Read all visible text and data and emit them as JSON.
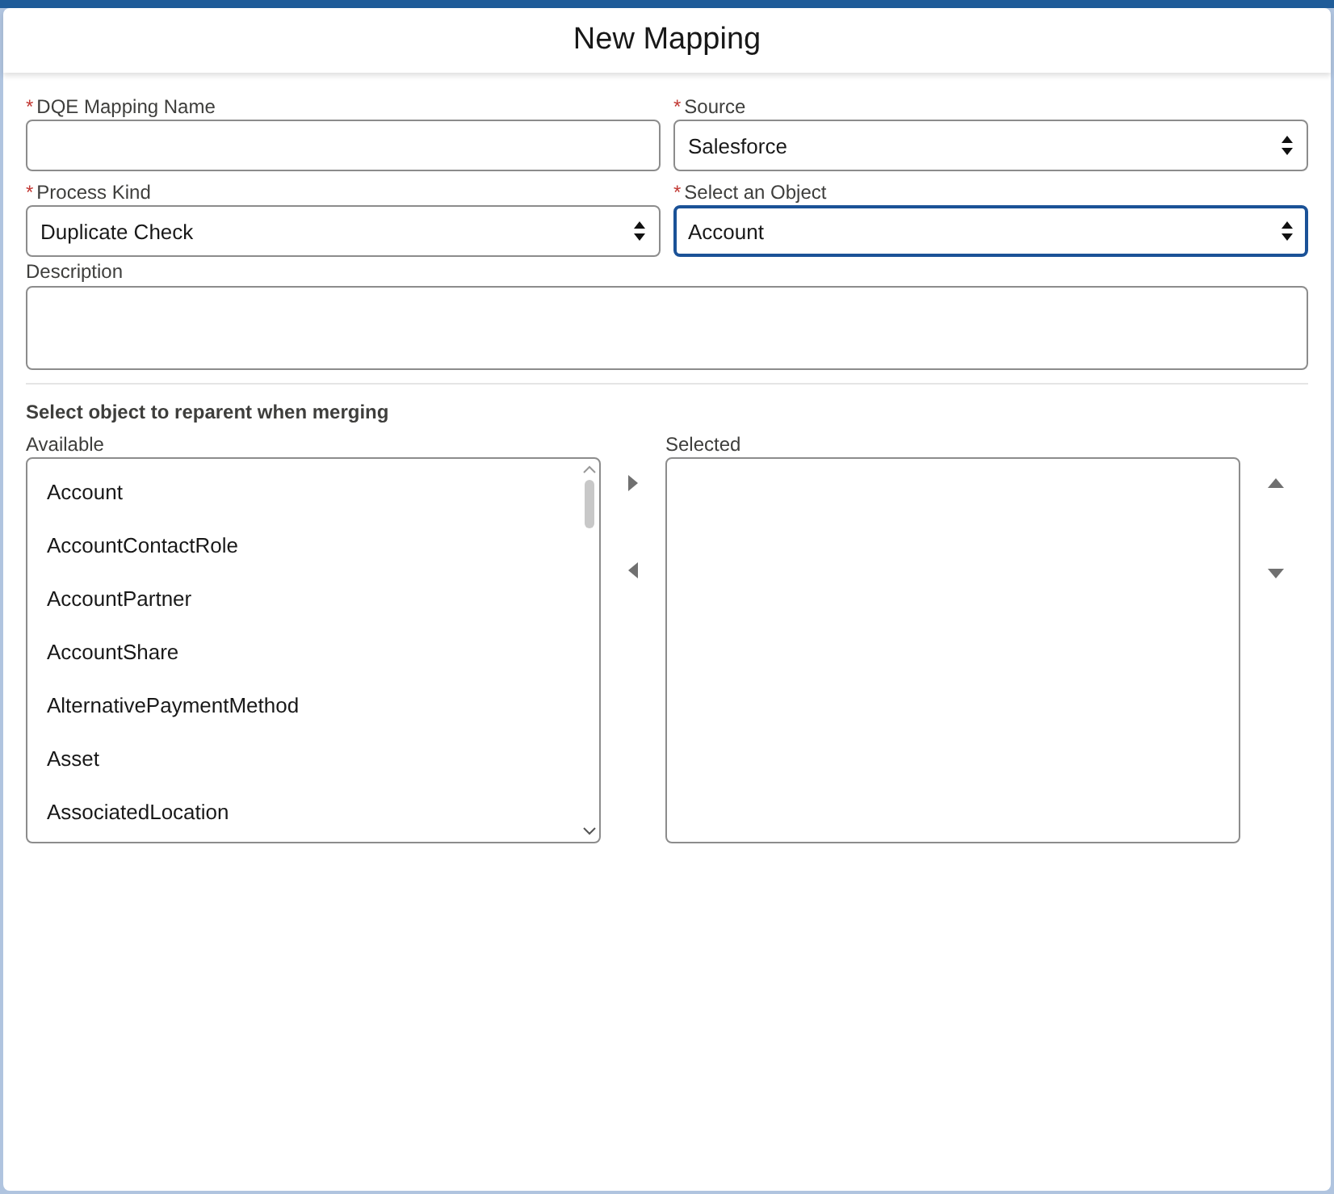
{
  "modal": {
    "title": "New Mapping"
  },
  "fields": [
    {
      "label": "DQE Mapping Name",
      "required_mark": "*",
      "kind": "text",
      "focused": false
    },
    {
      "label": "Source",
      "required_mark": "*",
      "kind": "select",
      "value": "Salesforce",
      "focused": false
    },
    {
      "label": "Process Kind",
      "required_mark": "*",
      "kind": "select",
      "value": "Duplicate Check",
      "focused": false
    },
    {
      "label": "Select an Object",
      "required_mark": "*",
      "kind": "select",
      "value": "Account",
      "focused": true
    },
    {
      "label": "Description",
      "kind": "textarea",
      "focused": false
    }
  ],
  "dual_list": {
    "title": "Select object to reparent when merging",
    "available_label": "Available",
    "selected_label": "Selected",
    "available": [
      "Account",
      "AccountContactRole",
      "AccountPartner",
      "AccountShare",
      "AlternativePaymentMethod",
      "Asset",
      "AssociatedLocation"
    ]
  }
}
